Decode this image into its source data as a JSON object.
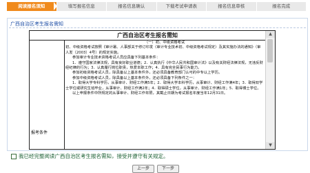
{
  "steps": [
    "阅读报名须知",
    "填写报名信息",
    "报名信息确认",
    "下载考试申请表",
    "报名信息审核",
    "报名完成"
  ],
  "active_step": 0,
  "section_title": "广西自治区考生报名需知",
  "doc": {
    "title": "广西自治区考生报名需知",
    "left_label": "报考条件",
    "lines": [
      {
        "t": "（一）初、中级资格考试",
        "c": "sec"
      },
      {
        "t": "初、中级资格考试按照《审计署、人事部关于修订印发〈审计专业技术初、中级资格考试规定〉及其实施办法的通知》（审人发〔2003〕4号）的规定实施。",
        "c": ""
      },
      {
        "t": "参加审计专业技术资格考试人员应具备下列基本条件：",
        "c": "ind"
      },
      {
        "t": "1．遵守国家法律法规，具有良好职业道德；2．认真执行《中华人民共和国审计法》以及有关财经法律法规，无违反财经纪律的行为；3．认真履行岗位职责，热爱本职工作；4．具有完全民事行为能力。",
        "c": "ind"
      },
      {
        "t": "参加初级资格考试人员，除具备以上基本条件外，还必须具备教育部门认可的中专以上学历。",
        "c": "ind"
      },
      {
        "t": "参加中级资格考试人员，除具备以上基本条件外，还必须具备下列条件之一：",
        "c": "ind"
      },
      {
        "t": "1．取得大学专科学历，从事审计、财经工作满5年；2．取得大学本科学历，从事审计、财经工作满4年；3．取得双学士学位或研究生班毕业，从事审计、财经工作满2年；4．取得硕士学位，从事审计、财经工作满1年；5．取得博士学位。",
        "c": "ind"
      },
      {
        "t": "以上申报条件中所规定的从事审计、财经工作年限，其截止日期为考试报名年度当年12月31日。",
        "c": "ind"
      }
    ]
  },
  "agreement_text": "我已经完整阅读广西自治区考生报名需知，接受并遵守有关规定。",
  "buttons": {
    "prev": "上一步",
    "next": "下一步"
  }
}
